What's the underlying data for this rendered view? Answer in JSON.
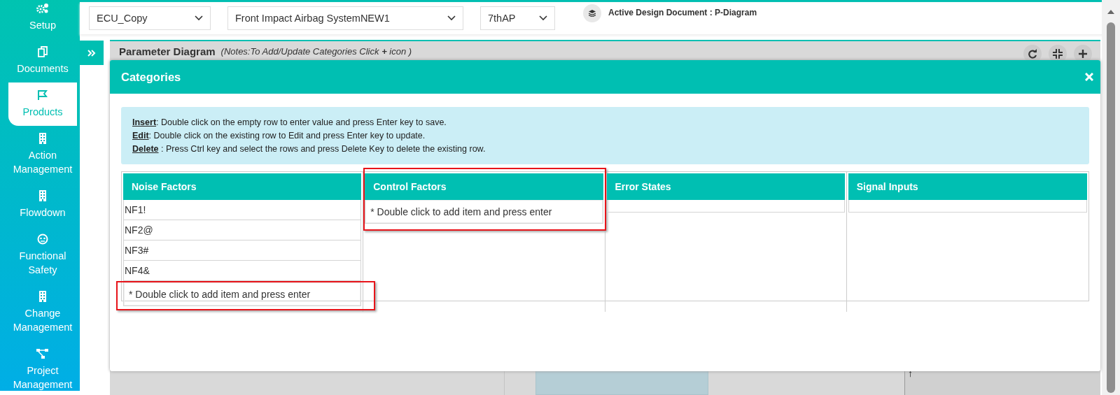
{
  "sidebar": {
    "items": [
      {
        "label": "Setup",
        "selected": false
      },
      {
        "label": "Documents",
        "selected": false
      },
      {
        "label": "Products",
        "selected": true
      },
      {
        "label": "Action Management",
        "selected": false
      },
      {
        "label": "Flowdown",
        "selected": false
      },
      {
        "label": "Functional Safety",
        "selected": false
      },
      {
        "label": "Change Management",
        "selected": false
      },
      {
        "label": "Project Management",
        "selected": false
      }
    ]
  },
  "toolbar": {
    "dropdowns": [
      {
        "value": "ECU_Copy"
      },
      {
        "value": "Front Impact Airbag SystemNEW1"
      },
      {
        "value": "7thAP"
      }
    ],
    "active_document": "Active Design Document : P-Diagram"
  },
  "panel": {
    "title": "Parameter Diagram",
    "note": "(Notes:To Add/Update Categories Click **+** icon )",
    "canvas_label": "↑"
  },
  "modal": {
    "title": "Categories",
    "instructions": [
      {
        "term": "Insert",
        "text": ": Double click on the empty row to enter value and press Enter key to save."
      },
      {
        "term": "Edit",
        "text": ": Double click on the existing row to Edit and press Enter key to update."
      },
      {
        "term": "Delete",
        "text": " : Press Ctrl key and select the rows and press Delete Key to delete the existing row."
      }
    ],
    "columns": [
      {
        "title": "Noise Factors",
        "items": [
          "NF1!",
          "NF2@",
          "NF3#",
          "NF4&"
        ],
        "add_hint": "* Double click to add item and press enter",
        "add_row_highlighted": true
      },
      {
        "title": "Control Factors",
        "add_hint": "* Double click to add item and press enter",
        "header_highlighted": true,
        "add_row_highlighted": true
      },
      {
        "title": "Error States"
      },
      {
        "title": "Signal Inputs"
      }
    ]
  }
}
